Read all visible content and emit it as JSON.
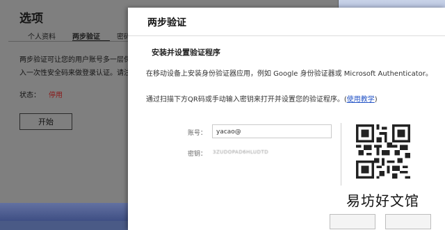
{
  "options": {
    "title": "选项",
    "tabs": [
      {
        "label": "个人资料",
        "active": false
      },
      {
        "label": "两步验证",
        "active": true
      },
      {
        "label": "密码",
        "active": false
      }
    ],
    "description_line1": "两步验证可让您的用户账号多一层保障",
    "description_line2": "入一次性安全码来做登录认证。请注意",
    "status_label": "状态：",
    "status_value": "停用",
    "start_button": "开始"
  },
  "dialog": {
    "title": "两步验证",
    "section_title": "安装并设置验证程序",
    "instruction1": "在移动设备上安装身份验证器应用，例如 Google 身份验证器或 Microsoft Authenticator。",
    "instruction2_prefix": "通过扫描下方QR码或手动输入密钥来打开并设置您的验证程序。(",
    "tutorial_link": "使用教学",
    "instruction2_suffix": ")",
    "account_label": "账号：",
    "account_value": "yacao@",
    "key_label": "密钥：",
    "key_value": "3ZUDOPAD6HLUDTD"
  },
  "watermark": "易坊好文馆",
  "colors": {
    "link": "#2454c6",
    "status_disabled": "#8a1717",
    "overlay": "#7f7f7f"
  }
}
